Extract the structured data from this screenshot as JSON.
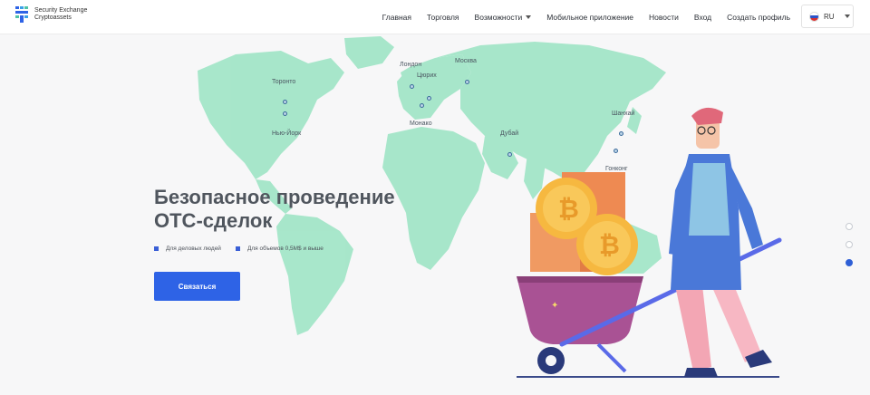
{
  "header": {
    "logo_line1": "Security Exchange",
    "logo_line2": "Cryptoassets",
    "nav": [
      {
        "label": "Главная"
      },
      {
        "label": "Торговля"
      },
      {
        "label": "Возможности"
      },
      {
        "label": "Мобильное приложение"
      },
      {
        "label": "Новости"
      },
      {
        "label": "Вход"
      },
      {
        "label": "Создать профиль"
      }
    ],
    "language": "RU"
  },
  "map": {
    "cities": [
      "Торонто",
      "Нью-Йорк",
      "Лондон",
      "Цюрих",
      "Монако",
      "Москва",
      "Дубай",
      "Шанхай",
      "Гонконг"
    ]
  },
  "hero": {
    "title": "Безопасное проведение ОТС-сделок",
    "bullets": [
      "Для деловых людей",
      "Для объемов 0,5М$ и выше"
    ],
    "cta": "Связаться"
  },
  "colors": {
    "map_land": "#a3e6c8",
    "accent": "#2e63e6",
    "coin": "#f6b840",
    "coin_stack": "#ee8a52",
    "wheelbarrow": "#a95294"
  }
}
